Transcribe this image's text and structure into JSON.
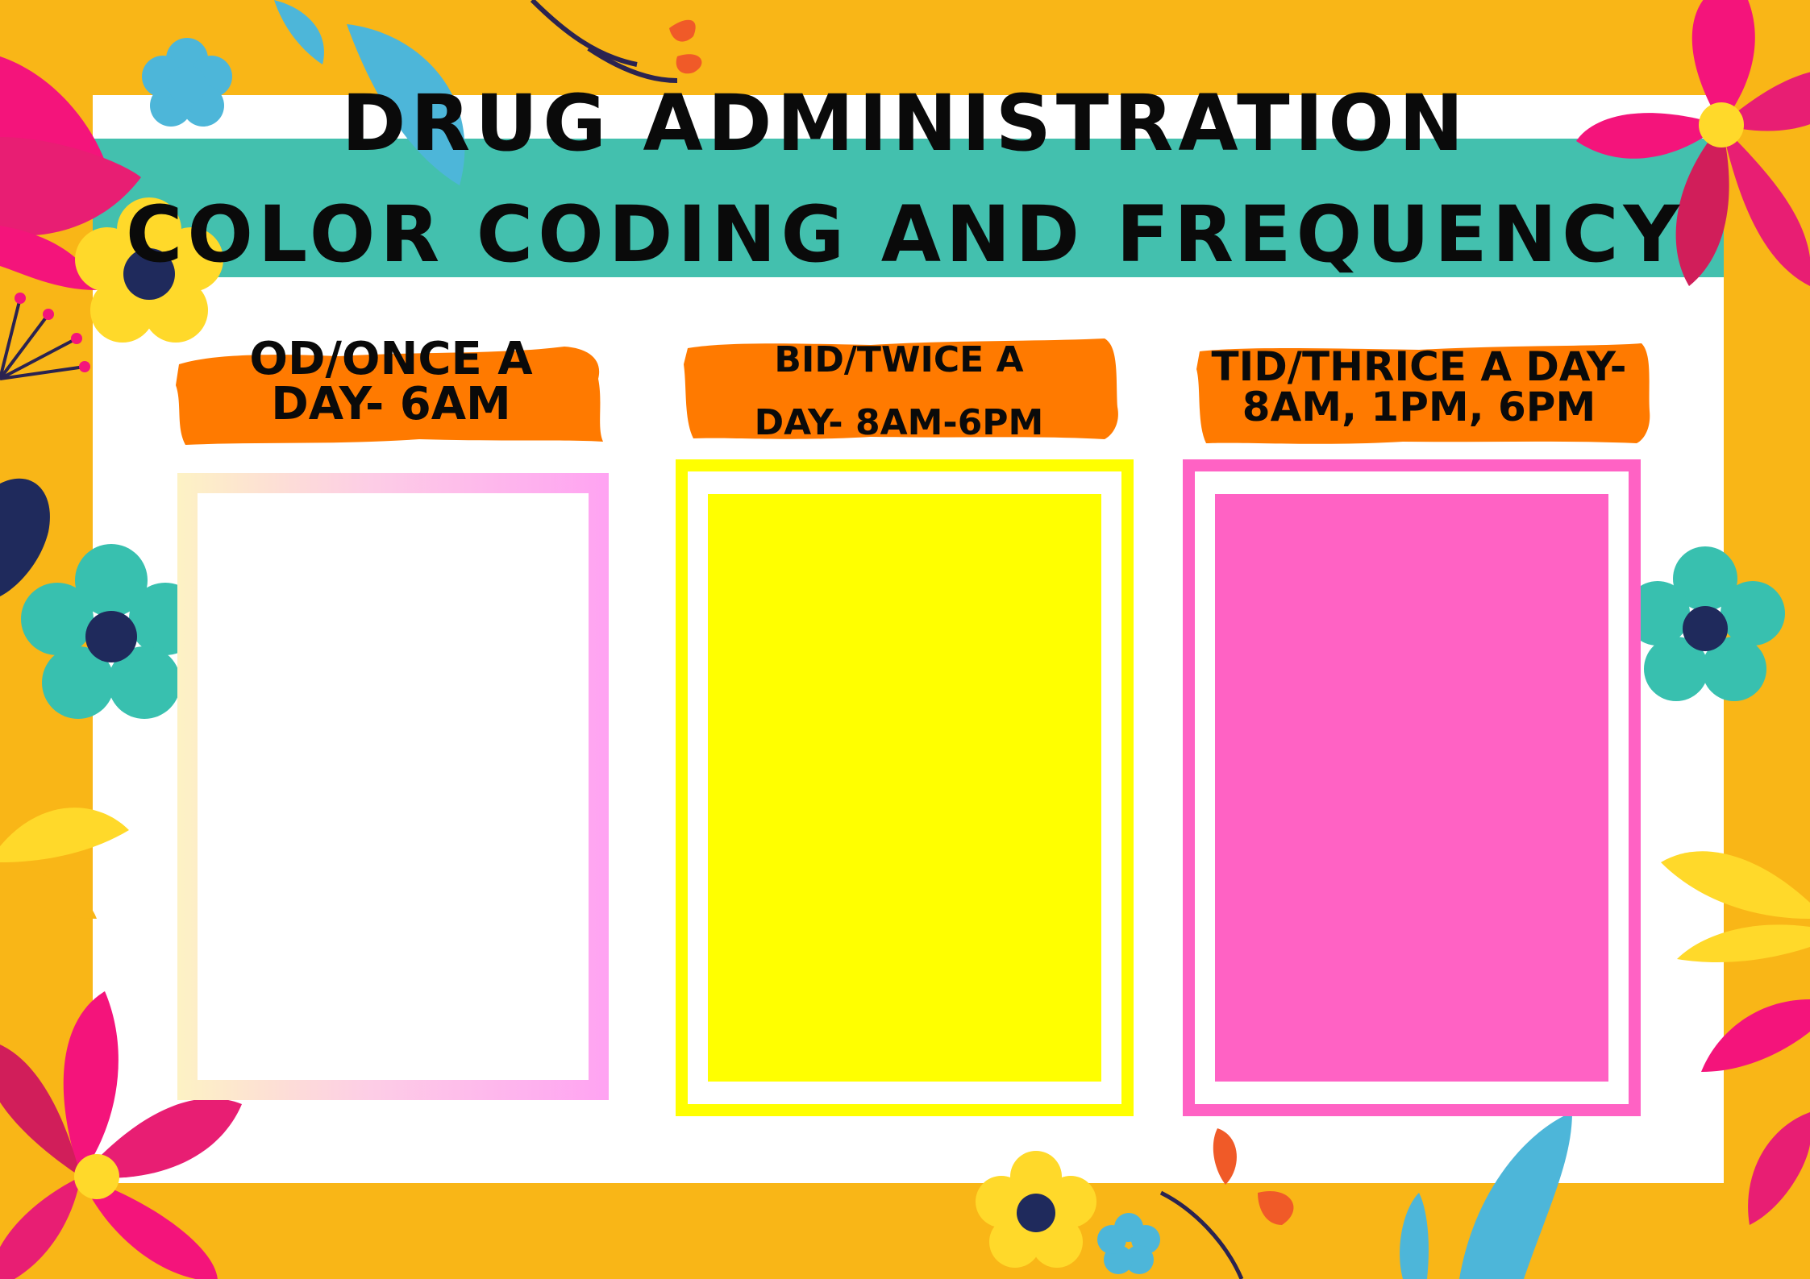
{
  "title": {
    "line1": "DRUG ADMINISTRATION",
    "line2": "COLOR CODING AND FREQUENCY"
  },
  "columns": [
    {
      "label_line1": "OD/ONCE A",
      "label_line2": "DAY- 6AM",
      "color_swatch": "white",
      "swatch_hex": "#FFFFFF"
    },
    {
      "label_line1": "BID/TWICE A",
      "label_line2": "DAY- 8AM-6PM",
      "color_swatch": "yellow",
      "swatch_hex": "#FFFF00"
    },
    {
      "label_line1": "TID/THRICE A DAY-",
      "label_line2": "8AM, 1PM, 6PM",
      "color_swatch": "pink",
      "swatch_hex": "#FF62C4"
    }
  ],
  "colors": {
    "background": "#F9B617",
    "panel": "#FFFFFF",
    "band": "#43C0AE",
    "label_brush": "#FF7A00",
    "text": "#0A0A0A"
  },
  "decorations": [
    "flower-icon",
    "leaf-icon",
    "branch-icon"
  ]
}
